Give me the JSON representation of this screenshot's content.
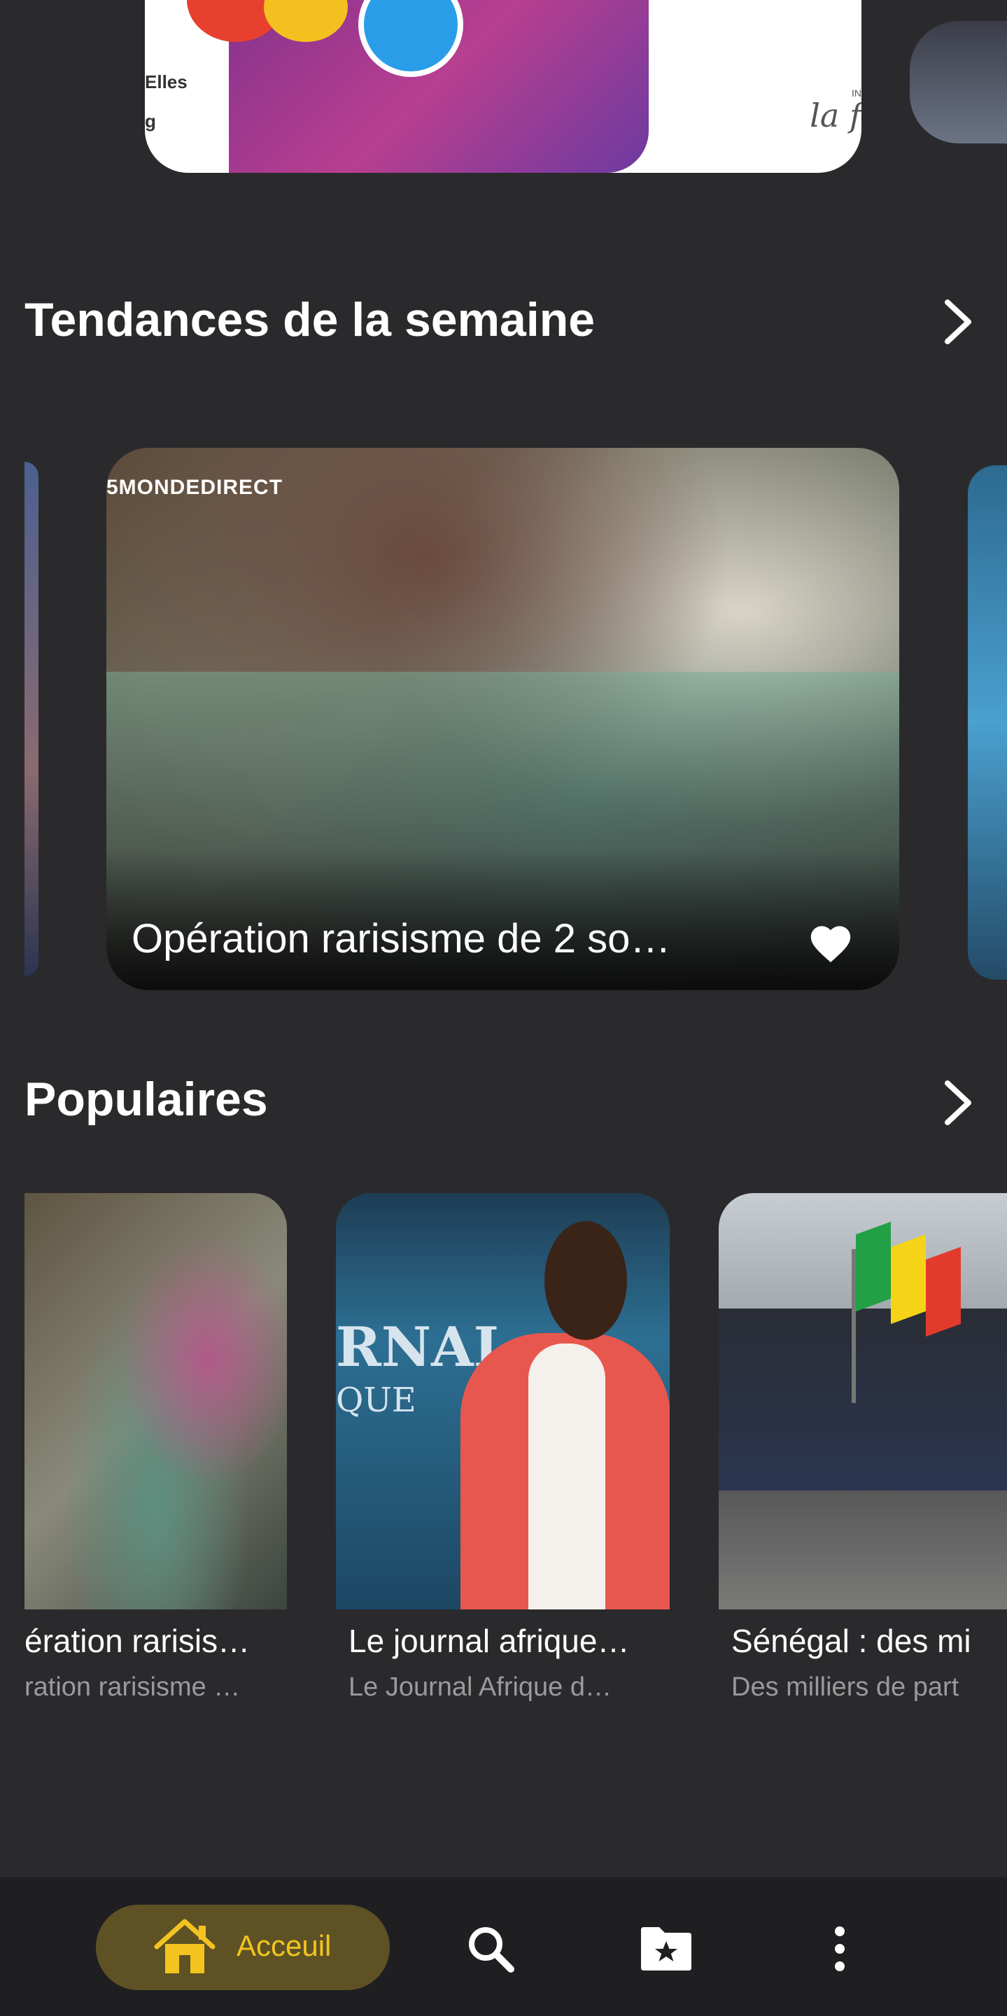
{
  "top_banner": {
    "text_left_1": "Elles",
    "text_left_2": "g",
    "brand_fragment": "la f",
    "brand_tag": "IN"
  },
  "sections": {
    "trends": {
      "title": "Tendances de la semaine",
      "featured": {
        "watermark": "5MONDEDIRECT",
        "caption": "Opération rarisisme de 2 so…",
        "favorite_icon": "heart-icon"
      }
    },
    "popular": {
      "title": "Populaires",
      "items": [
        {
          "title": "ération rarisis…",
          "subtitle": "ration rarisisme …"
        },
        {
          "title": "Le journal afrique…",
          "subtitle": "Le Journal Afrique d…",
          "logo_text": "RNAL",
          "logo_sub": "QUE"
        },
        {
          "title": "Sénégal : des mi",
          "subtitle": "Des milliers de part"
        }
      ]
    }
  },
  "bottom_nav": {
    "home_label": "Acceuil",
    "items": [
      "home-icon",
      "search-icon",
      "folder-star-icon",
      "more-vertical-icon"
    ]
  },
  "colors": {
    "background": "#2a2a2d",
    "nav_background": "#1f1f22",
    "accent": "#f3c420",
    "accent_pill": "#5e5225"
  }
}
